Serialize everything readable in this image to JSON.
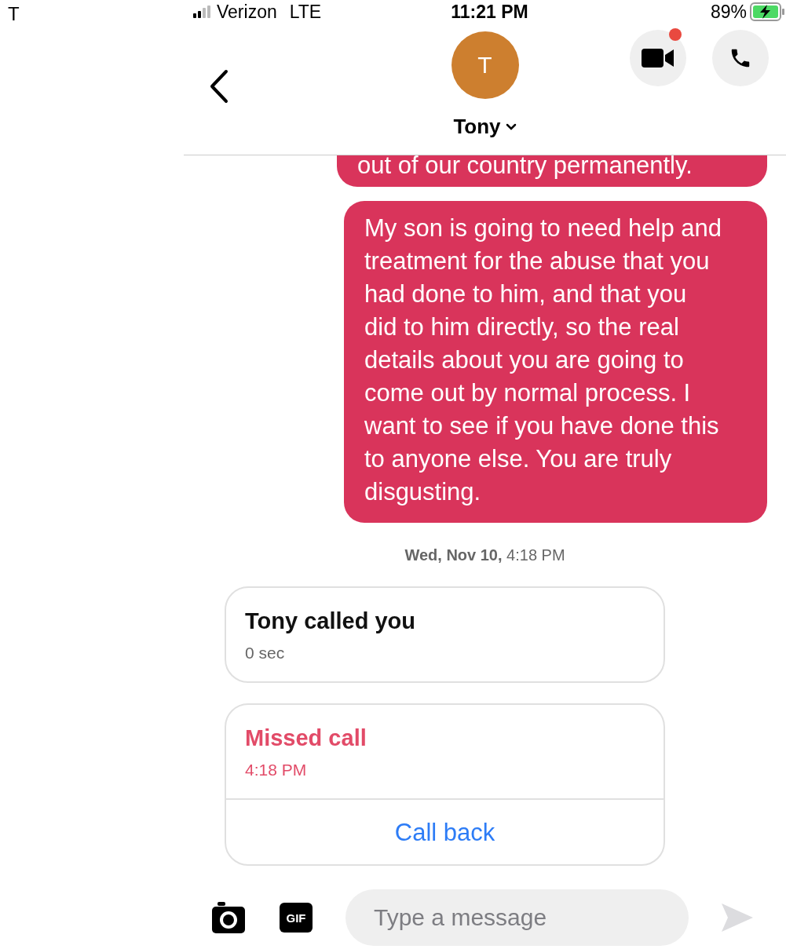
{
  "corner_label": "T",
  "status_bar": {
    "carrier": "Verizon",
    "network": "LTE",
    "time": "11:21 PM",
    "battery": "89%"
  },
  "header": {
    "avatar_initial": "T",
    "name": "Tony",
    "video_call_dot": true
  },
  "messages": [
    {
      "kind": "outgoing_partial",
      "text": "out of our country permanently."
    },
    {
      "kind": "outgoing",
      "text": "My son is going to need help and treatment for the abuse that you had done to him, and that you did to him directly, so the real details about you are going to come out by normal process. I want to see if you have done this to anyone else. You are truly disgusting."
    },
    {
      "kind": "timestamp",
      "text": "**Wed, Nov 10,** 4:18 PM"
    },
    {
      "kind": "call",
      "title": "Tony called you",
      "detail": "0 sec",
      "missed": false
    },
    {
      "kind": "call",
      "title": "Missed call",
      "detail": "4:18 PM",
      "missed": true,
      "action": "Call back"
    }
  ],
  "composer": {
    "placeholder": "Type a message",
    "gif_label": "GIF"
  }
}
